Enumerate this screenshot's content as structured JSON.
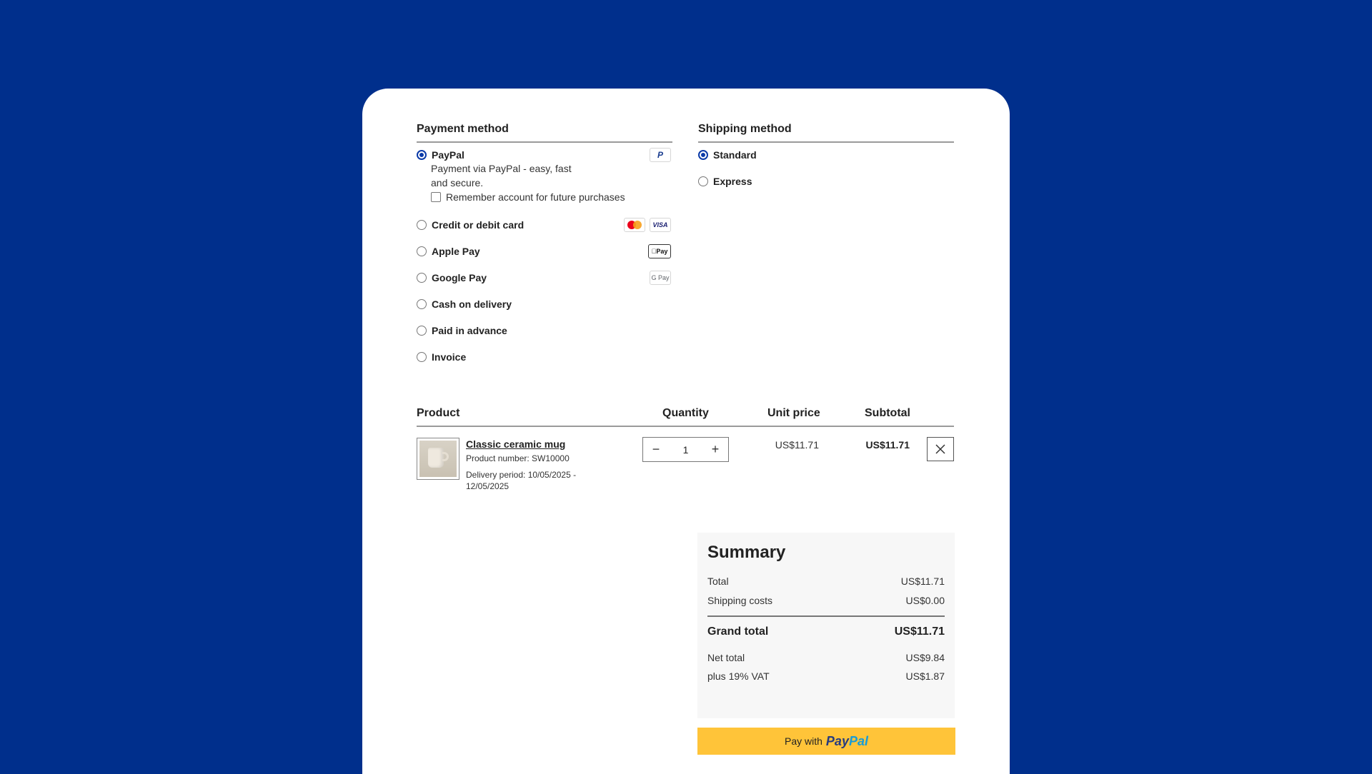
{
  "payment": {
    "title": "Payment method",
    "paypal": {
      "label": "PayPal",
      "description": "Payment via PayPal - easy, fast and secure.",
      "remember_label": "Remember account for future purchases"
    },
    "options": [
      {
        "label": "Credit or debit card"
      },
      {
        "label": "Apple Pay"
      },
      {
        "label": "Google Pay"
      },
      {
        "label": "Cash on delivery"
      },
      {
        "label": "Paid in advance"
      },
      {
        "label": "Invoice"
      }
    ],
    "logos": {
      "paypal": "P",
      "visa": "VISA",
      "applepay": "Pay",
      "googlepay": "G Pay"
    }
  },
  "shipping": {
    "title": "Shipping method",
    "options": [
      {
        "label": "Standard",
        "selected": true
      },
      {
        "label": "Express",
        "selected": false
      }
    ]
  },
  "cart": {
    "headers": {
      "product": "Product",
      "quantity": "Quantity",
      "unit_price": "Unit price",
      "subtotal": "Subtotal"
    },
    "item": {
      "name": "Classic ceramic mug",
      "product_number": "Product number: SW10000",
      "delivery": "Delivery period: 10/05/2025 - 12/05/2025",
      "quantity": "1",
      "unit_price": "US$11.71",
      "subtotal": "US$11.71"
    }
  },
  "summary": {
    "title": "Summary",
    "total_label": "Total",
    "total_value": "US$11.71",
    "shipping_label": "Shipping costs",
    "shipping_value": "US$0.00",
    "grand_label": "Grand total",
    "grand_value": "US$11.71",
    "net_label": "Net total",
    "net_value": "US$9.84",
    "vat_label": "plus 19% VAT",
    "vat_value": "US$1.87"
  },
  "paypal_button": {
    "prefix": "Pay with",
    "brand1": "Pay",
    "brand2": "Pal"
  },
  "colors": {
    "background": "#002f8c",
    "accent": "#0a3aa8",
    "paypal_yellow": "#ffc439"
  }
}
